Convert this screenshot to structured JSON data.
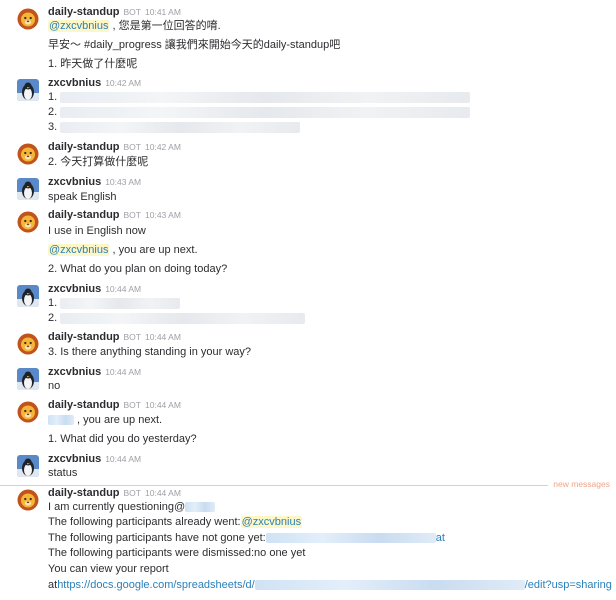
{
  "bot_name": "daily-standup",
  "bot_tag": "BOT",
  "user_name": "zxcvbnius",
  "new_messages_label": "new messages",
  "messages": [
    {
      "time": "10:41 AM",
      "mention": "@zxcvbnius",
      "l1_rest": " , 您是第一位回答的唷.",
      "l2": "早安～ #daily_progress 讓我們來開始今天的daily-standup吧",
      "l3": "1. 昨天做了什麼呢"
    },
    {
      "time": "10:42 AM",
      "p1": "1.",
      "p2": "2.",
      "p3": "3."
    },
    {
      "time": "10:42 AM",
      "l1": "2. 今天打算做什麼呢"
    },
    {
      "time": "10:43 AM",
      "l1": "speak English"
    },
    {
      "time": "10:43 AM",
      "l1": "I use in English now",
      "mention": "@zxcvbnius",
      "l2_rest": " , you are up next.",
      "l3": "2. What do you plan on doing today?"
    },
    {
      "time": "10:44 AM",
      "p1": "1.",
      "p2": "2."
    },
    {
      "time": "10:44 AM",
      "l1": "3. Is there anything standing in your way?"
    },
    {
      "time": "10:44 AM",
      "l1": "no"
    },
    {
      "time": "10:44 AM",
      "l1_rest": " , you are up next.",
      "l2": "1. What did you do yesterday?"
    },
    {
      "time": "10:44 AM",
      "l1": "status"
    },
    {
      "time": "10:44 AM",
      "l1": "I am currently questioning@",
      "l2": "The following participants already went:",
      "l2_mention": "@zxcvbnius",
      "l3": "The following participants have not gone yet:",
      "l3_tail": "at",
      "l4": "The following participants were dismissed:no one yet",
      "l5": "You can view your report",
      "l6_prefix": "at",
      "l6_link_start": "https://docs.google.com/spreadsheets/d/",
      "l6_link_end": "/edit?usp=sharing"
    }
  ],
  "colors": {
    "mention_bg": "#fdf6c7",
    "link": "#2a80b9",
    "new_messages": "#f2a487"
  }
}
